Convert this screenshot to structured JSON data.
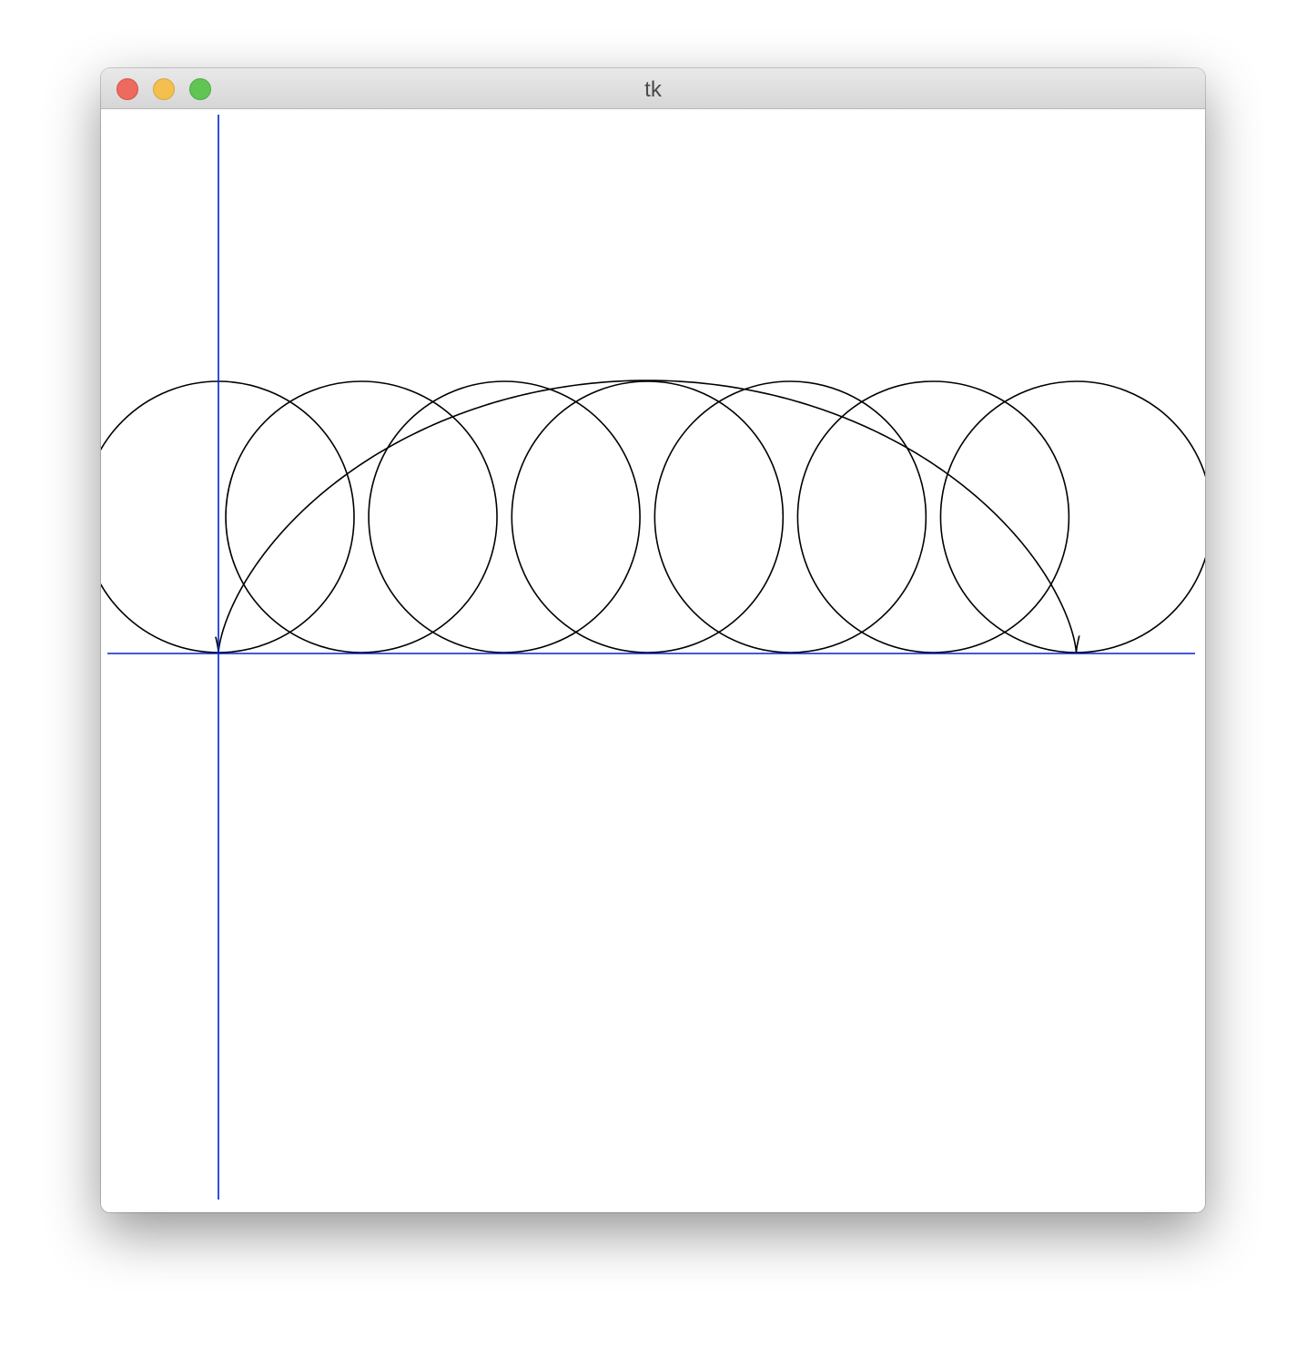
{
  "window": {
    "title": "tk"
  },
  "colors": {
    "axis": "#0022cc",
    "curve": "#000000",
    "circle": "#000000",
    "background": "#ffffff"
  },
  "icons": [
    "close-button",
    "minimize-button",
    "zoom-button"
  ],
  "figure": {
    "radius": 1,
    "circle_centers_x": [
      0,
      1.047,
      2.094,
      3.142,
      4.189,
      5.236,
      6.283
    ],
    "curve_t_range": [
      -0.5,
      6.8
    ]
  }
}
